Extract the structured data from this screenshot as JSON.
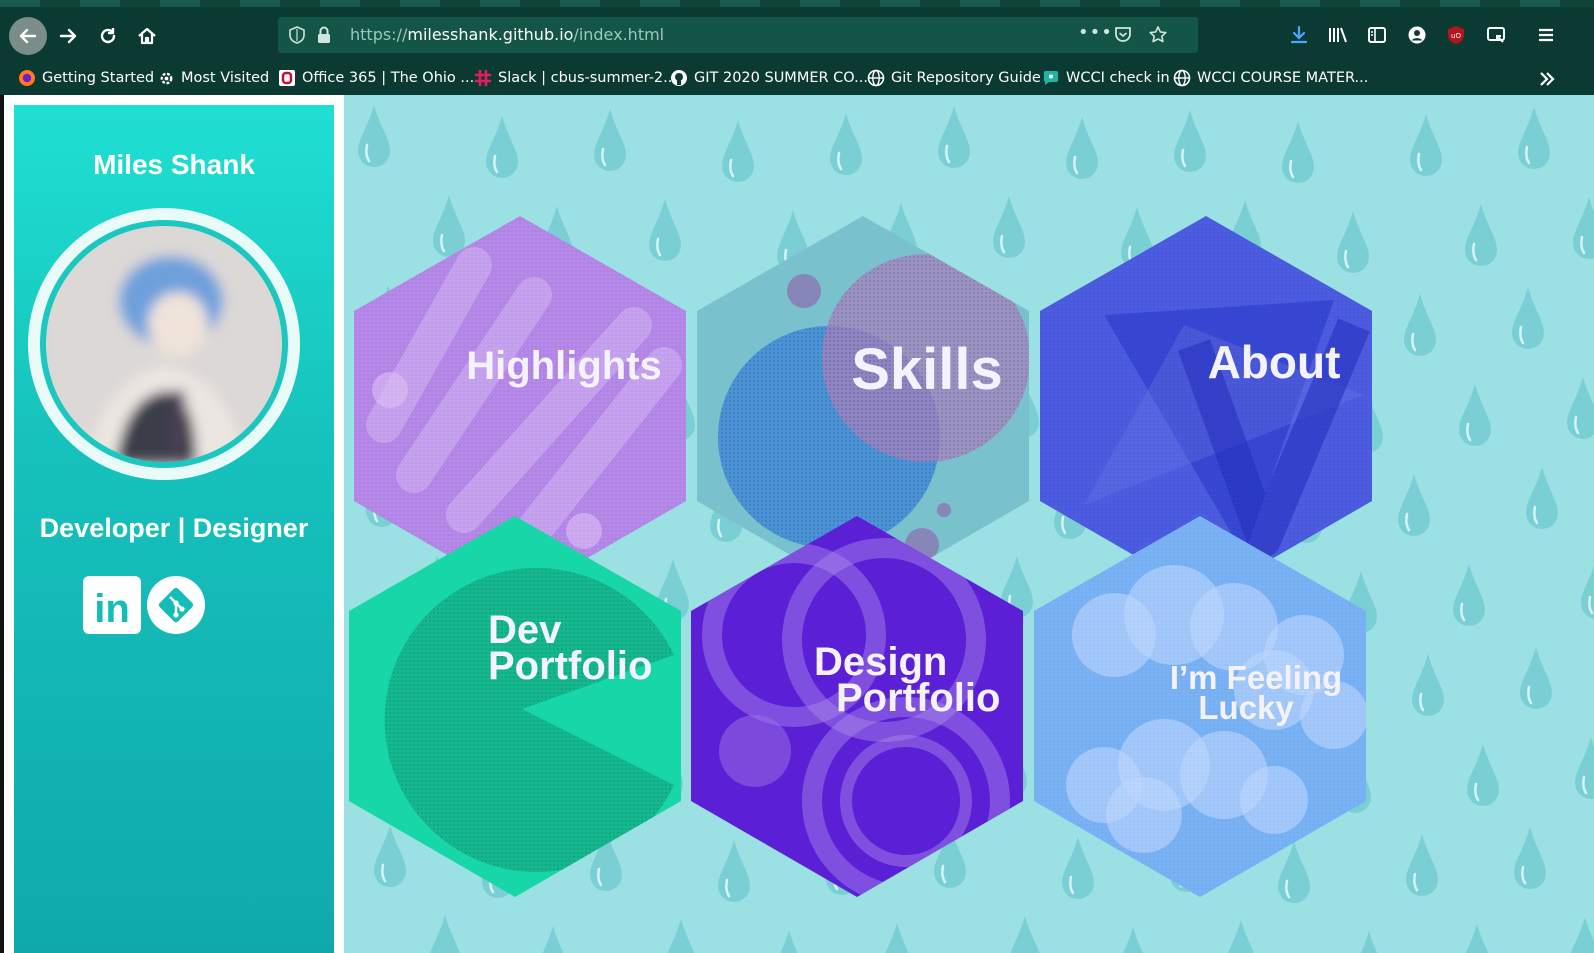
{
  "browser": {
    "url_prefix": "https://",
    "url_host": "milesshank.github.io",
    "url_path": "/index.html",
    "colors": {
      "chrome": "#0b3a32",
      "urlbar": "#135547"
    }
  },
  "bookmarks": [
    {
      "label": "Getting Started",
      "icon": "firefox-icon"
    },
    {
      "label": "Most Visited",
      "icon": "gear-icon"
    },
    {
      "label": "Office 365 | The Ohio ...",
      "icon": "office-icon"
    },
    {
      "label": "Slack | cbus-summer-2...",
      "icon": "slack-icon"
    },
    {
      "label": "GIT 2020 SUMMER CO...",
      "icon": "github-icon"
    },
    {
      "label": "Git Repository Guide",
      "icon": "globe-icon"
    },
    {
      "label": "WCCI check in",
      "icon": "chat-icon"
    },
    {
      "label": "WCCI COURSE MATER...",
      "icon": "globe-icon"
    }
  ],
  "sidebar": {
    "name": "Miles Shank",
    "role": "Developer | Designer",
    "social": [
      {
        "label": "in",
        "icon": "linkedin-icon"
      },
      {
        "label": "",
        "icon": "git-icon"
      }
    ],
    "colors": {
      "top": "#1fe0d2",
      "bottom": "#0fa9ac"
    }
  },
  "tiles": [
    {
      "line1": "Highlights",
      "line2": "",
      "color": "#b184e6"
    },
    {
      "line1": "Skills",
      "line2": "",
      "color": "#79c2cd"
    },
    {
      "line1": "About",
      "line2": "",
      "color": "#4b5ce0"
    },
    {
      "line1": "Dev",
      "line2": "Portfolio",
      "color": "#17d6a8"
    },
    {
      "line1": "Design",
      "line2": "Portfolio",
      "color": "#5b1fd6"
    },
    {
      "line1": "I’m Feeling",
      "line2": "Lucky",
      "color": "#78b2f4"
    }
  ],
  "background": {
    "color": "#9be0e3",
    "pattern": "raindrop-icon"
  }
}
